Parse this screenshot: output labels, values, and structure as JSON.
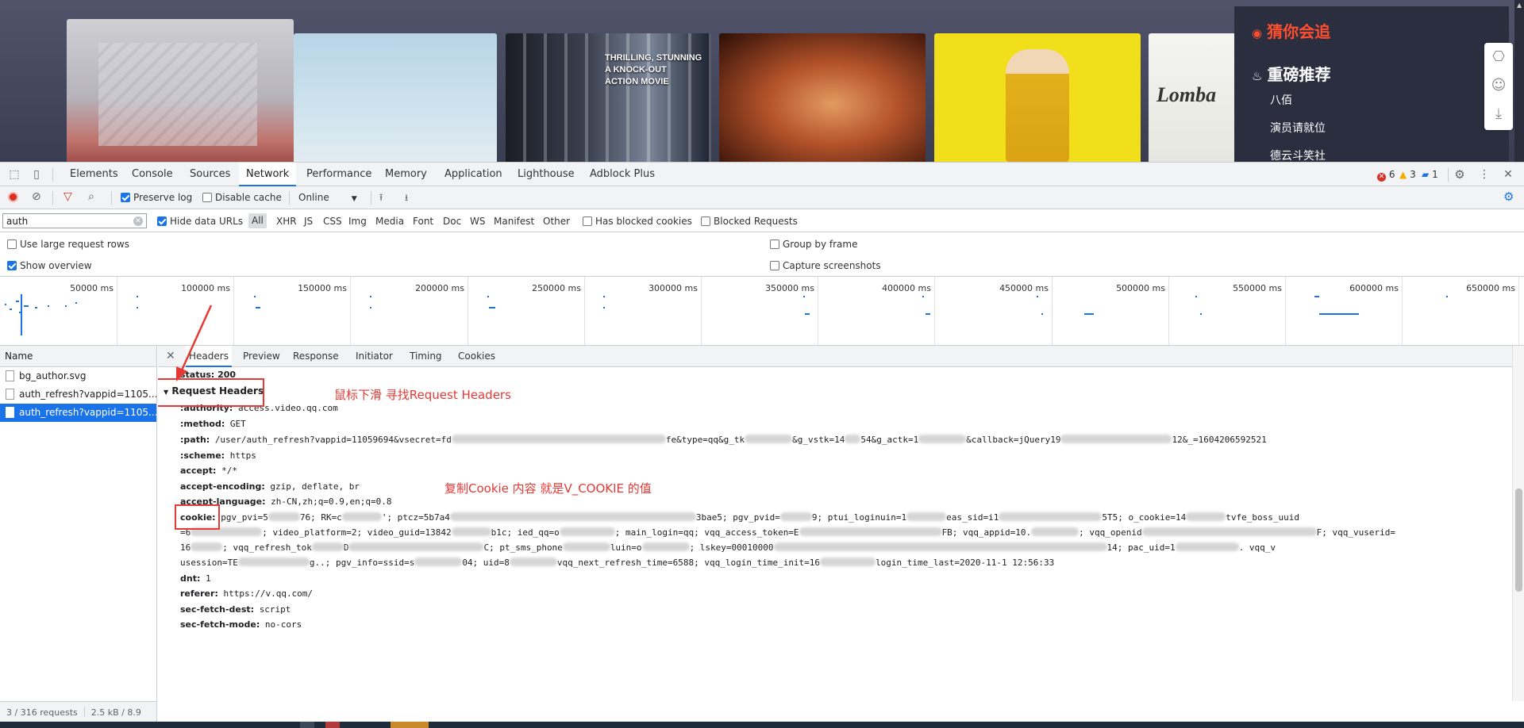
{
  "website": {
    "posters": [
      {
        "text": ""
      },
      {
        "text": ""
      },
      {
        "text": "THRILLING, STUNNING\nA KNOCK-OUT\nACTION MOVIE"
      },
      {
        "text": ""
      },
      {
        "text": ""
      },
      {
        "text": "Lomba"
      }
    ],
    "rec_title_1": "猜你会追",
    "rec_title_2": "重磅推荐",
    "rec_items": [
      "八佰",
      "演员请就位",
      "德云斗笑社"
    ]
  },
  "devtools": {
    "tabs": [
      "Elements",
      "Console",
      "Sources",
      "Network",
      "Performance",
      "Memory",
      "Application",
      "Lighthouse",
      "Adblock Plus"
    ],
    "active_tab": "Network",
    "errors": "6",
    "warnings": "3",
    "infos": "1",
    "toolbar": {
      "preserve_log": "Preserve log",
      "disable_cache": "Disable cache",
      "throttle": "Online"
    },
    "filter": {
      "value": "auth",
      "hide_data_urls": "Hide data URLs",
      "types": [
        "All",
        "XHR",
        "JS",
        "CSS",
        "Img",
        "Media",
        "Font",
        "Doc",
        "WS",
        "Manifest",
        "Other"
      ],
      "has_blocked_cookies": "Has blocked cookies",
      "blocked_requests": "Blocked Requests"
    },
    "options": {
      "large_rows": "Use large request rows",
      "show_overview": "Show overview",
      "group_by_frame": "Group by frame",
      "capture_screenshots": "Capture screenshots"
    },
    "timeline_labels": [
      "50000 ms",
      "100000 ms",
      "150000 ms",
      "200000 ms",
      "250000 ms",
      "300000 ms",
      "350000 ms",
      "400000 ms",
      "450000 ms",
      "500000 ms",
      "550000 ms",
      "600000 ms",
      "650000 ms"
    ],
    "requests": {
      "header": "Name",
      "rows": [
        "bg_author.svg",
        "auth_refresh?vappid=1105...",
        "auth_refresh?vappid=1105..."
      ],
      "status": "3 / 316 requests",
      "size": "2.5 kB / 8.9"
    },
    "detail": {
      "tabs": [
        "Headers",
        "Preview",
        "Response",
        "Initiator",
        "Timing",
        "Cookies"
      ],
      "status_line": "status: 200",
      "section": "Request Headers",
      "headers": [
        {
          "k": ":authority:",
          "v": "access.video.qq.com"
        },
        {
          "k": ":method:",
          "v": "GET"
        },
        {
          "k": ":path:",
          "v": "/user/auth_refresh?vappid=11059694&vsecret=fd"
        },
        {
          "k": ":scheme:",
          "v": "https"
        },
        {
          "k": "accept:",
          "v": "*/*"
        },
        {
          "k": "accept-encoding:",
          "v": "gzip, deflate, br"
        },
        {
          "k": "accept-language:",
          "v": "zh-CN,zh;q=0.9,en;q=0.8"
        },
        {
          "k": "cookie:",
          "v": "pgv_pvi=5"
        },
        {
          "k": "dnt:",
          "v": "1"
        },
        {
          "k": "referer:",
          "v": "https://v.qq.com/"
        },
        {
          "k": "sec-fetch-dest:",
          "v": "script"
        },
        {
          "k": "sec-fetch-mode:",
          "v": "no-cors"
        }
      ],
      "path_tail": {
        "a": "fe&type=qq&g_tk",
        "b": "&g_vstk=14",
        "c": "54&g_actk=1",
        "d": "&callback=jQuery19",
        "e": "12&_=1604206592521"
      },
      "cookie_bits": {
        "a": "76; RK=c",
        "b": "'; ptcz=5b7a4",
        "c": "3bae5; pgv_pvid=",
        "d": "9; ptui_loginuin=1",
        "e": "eas_sid=i1",
        "f": "5T5; o_cookie=14",
        "g": "tvfe_boss_uuid",
        "l2a": "=6",
        "l2b": "; video_platform=2; video_guid=13842",
        "l2c": "b1c; ied_qq=o",
        "l2d": "; main_login=qq; vqq_access_token=E",
        "l2e": "FB; vqq_appid=10.",
        "l2f": "; vqq_openid",
        "l2g": "F; vqq_vuserid=",
        "l3a": "16",
        "l3b": "; vqq_refresh_tok",
        "l3c": "D",
        "l3d": "C; pt_sms_phone",
        "l3e": "luin=o",
        "l3f": "; lskey=00010000",
        "l3g": "14; pac_uid=1",
        "l3h": ". vqq_v",
        "l4a": "usession=TE",
        "l4b": "g..; pgv_info=ssid=s",
        "l4c": "04; uid=8",
        "l4d": "vqq_next_refresh_time=6588; vqq_login_time_init=16",
        "l4e": "login_time_last=2020-11-1 12:56:33"
      }
    }
  },
  "annotations": {
    "scroll_hint": "鼠标下滑 寻找Request Headers",
    "cookie_hint": "复制Cookie 内容 就是V_COOKIE 的值"
  },
  "colors": {
    "accent": "#1a73e8",
    "annotation": "#e53935",
    "recommend_highlight": "#ff4e2e"
  }
}
